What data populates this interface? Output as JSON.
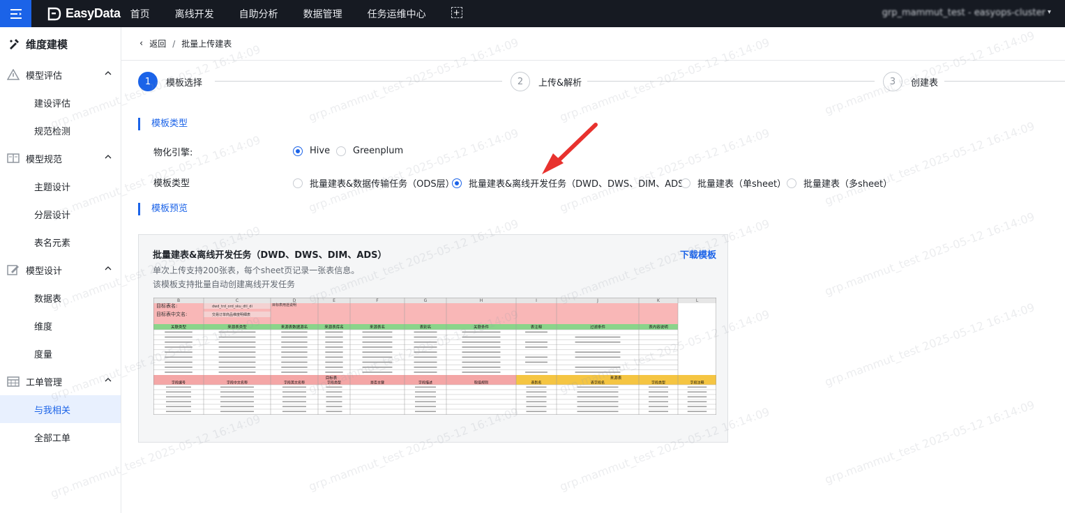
{
  "topbar": {
    "brand": "EasyData",
    "nav": [
      "首页",
      "离线开发",
      "自助分析",
      "数据管理",
      "任务运维中心"
    ],
    "add_symbol": "+",
    "user": "grp_mammut_test - easyops-cluster"
  },
  "sidebar": {
    "title": "维度建模",
    "groups": [
      {
        "label": "模型评估",
        "items": [
          "建设评估",
          "规范检测"
        ]
      },
      {
        "label": "模型规范",
        "items": [
          "主题设计",
          "分层设计",
          "表名元素"
        ]
      },
      {
        "label": "模型设计",
        "items": [
          "数据表",
          "维度",
          "度量"
        ]
      },
      {
        "label": "工单管理",
        "items": [
          "与我相关",
          "全部工单"
        ]
      }
    ],
    "active_item": "与我相关"
  },
  "breadcrumb": {
    "back": "返回",
    "separator": "/",
    "current": "批量上传建表"
  },
  "steps": [
    {
      "num": "1",
      "label": "模板选择",
      "active": true
    },
    {
      "num": "2",
      "label": "上传&解析",
      "active": false
    },
    {
      "num": "3",
      "label": "创建表",
      "active": false
    }
  ],
  "section_type": {
    "title": "模板类型",
    "engine_label": "物化引擎:",
    "engines": [
      "Hive",
      "Greenplum"
    ],
    "engine_selected": "Hive",
    "template_label": "模板类型",
    "templates": [
      "批量建表&数据传输任务（ODS层）",
      "批量建表&离线开发任务（DWD、DWS、DIM、ADS）",
      "批量建表（单sheet）",
      "批量建表（多sheet）"
    ],
    "template_selected": "批量建表&离线开发任务（DWD、DWS、DIM、ADS）"
  },
  "section_preview": {
    "title": "模板预览",
    "card_title": "批量建表&离线开发任务（DWD、DWS、DIM、ADS）",
    "download": "下载模板",
    "desc1": "单次上传支持200张表，每个sheet页记录一张表信息。",
    "desc2": "该模板支持批量自动创建离线开发任务"
  },
  "sheet": {
    "cols": [
      "B",
      "C",
      "D",
      "E",
      "F",
      "G",
      "H",
      "I",
      "J",
      "K",
      "L"
    ],
    "row1_label": "目标表名:",
    "row1_value": "dwd_trd_ord_sku_dtl_di",
    "row1_note": "目标表用途说明",
    "row2_label": "目标表中文名:",
    "row2_value": "交易订单商品维度明细表",
    "header1": [
      "关联类型",
      "来源表类型",
      "来源表数据源名",
      "来源表库名",
      "来源表名",
      "表别名",
      "关联条件",
      "表注释",
      "过滤条件",
      "表内容说明"
    ],
    "header2_groups": [
      "目标表",
      "来源表"
    ],
    "header2": [
      "字段编号",
      "字段中文名称",
      "字段英文名称",
      "字段类型",
      "是否主键",
      "字段描述",
      "取值规则",
      "表别名",
      "表字段名",
      "字段类型",
      "字段注释"
    ]
  },
  "watermark": "grp.mammut_test 2025-05-12 16:14:09",
  "colors": {
    "accent": "#1b63e8",
    "topbar": "#161a22",
    "annotation_arrow": "#e8322e"
  }
}
